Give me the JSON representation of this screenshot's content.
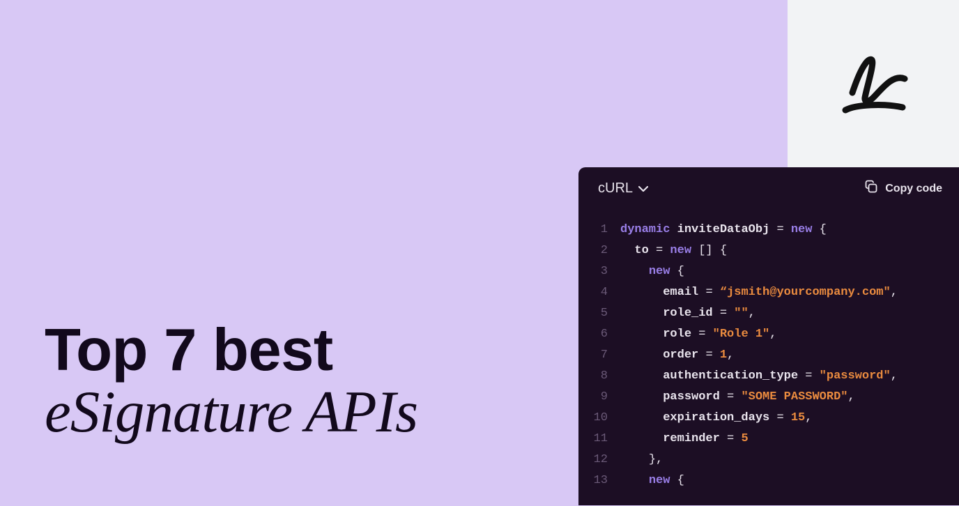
{
  "headline": {
    "line1": "Top 7 best",
    "line2": "eSignature APIs"
  },
  "codePanel": {
    "language": "cURL",
    "copyLabel": "Copy code",
    "lines": [
      {
        "n": 1,
        "indent": 0,
        "tokens": [
          [
            "kw",
            "dynamic"
          ],
          [
            "sp",
            " "
          ],
          [
            "id",
            "inviteDataObj"
          ],
          [
            "sp",
            " "
          ],
          [
            "op",
            "="
          ],
          [
            "sp",
            " "
          ],
          [
            "kw",
            "new"
          ],
          [
            "sp",
            " "
          ],
          [
            "br",
            "{"
          ]
        ]
      },
      {
        "n": 2,
        "indent": 1,
        "tokens": [
          [
            "prop",
            "to"
          ],
          [
            "sp",
            " "
          ],
          [
            "op",
            "="
          ],
          [
            "sp",
            " "
          ],
          [
            "kw",
            "new"
          ],
          [
            "sp",
            " "
          ],
          [
            "br",
            "[]"
          ],
          [
            "sp",
            " "
          ],
          [
            "br",
            "{"
          ]
        ]
      },
      {
        "n": 3,
        "indent": 2,
        "tokens": [
          [
            "kw",
            "new"
          ],
          [
            "sp",
            " "
          ],
          [
            "br",
            "{"
          ]
        ]
      },
      {
        "n": 4,
        "indent": 3,
        "tokens": [
          [
            "prop",
            "email"
          ],
          [
            "sp",
            " "
          ],
          [
            "op",
            "="
          ],
          [
            "sp",
            " "
          ],
          [
            "str",
            "“jsmith@yourcompany.com\""
          ],
          [
            "op",
            ","
          ]
        ]
      },
      {
        "n": 5,
        "indent": 3,
        "tokens": [
          [
            "prop",
            "role_id"
          ],
          [
            "sp",
            " "
          ],
          [
            "op",
            "="
          ],
          [
            "sp",
            " "
          ],
          [
            "str",
            "\"\""
          ],
          [
            "op",
            ","
          ]
        ]
      },
      {
        "n": 6,
        "indent": 3,
        "tokens": [
          [
            "prop",
            "role"
          ],
          [
            "sp",
            " "
          ],
          [
            "op",
            "="
          ],
          [
            "sp",
            " "
          ],
          [
            "str",
            "\"Role 1\""
          ],
          [
            "op",
            ","
          ]
        ]
      },
      {
        "n": 7,
        "indent": 3,
        "tokens": [
          [
            "prop",
            "order"
          ],
          [
            "sp",
            " "
          ],
          [
            "op",
            "="
          ],
          [
            "sp",
            " "
          ],
          [
            "num",
            "1"
          ],
          [
            "op",
            ","
          ]
        ]
      },
      {
        "n": 8,
        "indent": 3,
        "tokens": [
          [
            "prop",
            "authentication_type"
          ],
          [
            "sp",
            " "
          ],
          [
            "op",
            "="
          ],
          [
            "sp",
            " "
          ],
          [
            "str",
            "\"password\""
          ],
          [
            "op",
            ","
          ]
        ]
      },
      {
        "n": 9,
        "indent": 3,
        "tokens": [
          [
            "prop",
            "password"
          ],
          [
            "sp",
            " "
          ],
          [
            "op",
            "="
          ],
          [
            "sp",
            " "
          ],
          [
            "str",
            "\"SOME PASSWORD\""
          ],
          [
            "op",
            ","
          ]
        ]
      },
      {
        "n": 10,
        "indent": 3,
        "tokens": [
          [
            "prop",
            "expiration_days"
          ],
          [
            "sp",
            " "
          ],
          [
            "op",
            "="
          ],
          [
            "sp",
            " "
          ],
          [
            "num",
            "15"
          ],
          [
            "op",
            ","
          ]
        ]
      },
      {
        "n": 11,
        "indent": 3,
        "tokens": [
          [
            "prop",
            "reminder"
          ],
          [
            "sp",
            " "
          ],
          [
            "op",
            "="
          ],
          [
            "sp",
            " "
          ],
          [
            "num",
            "5"
          ]
        ]
      },
      {
        "n": 12,
        "indent": 2,
        "tokens": [
          [
            "br",
            "}"
          ],
          [
            "op",
            ","
          ]
        ]
      },
      {
        "n": 13,
        "indent": 2,
        "tokens": [
          [
            "kw",
            "new"
          ],
          [
            "sp",
            " "
          ],
          [
            "br",
            "{"
          ]
        ]
      }
    ]
  }
}
